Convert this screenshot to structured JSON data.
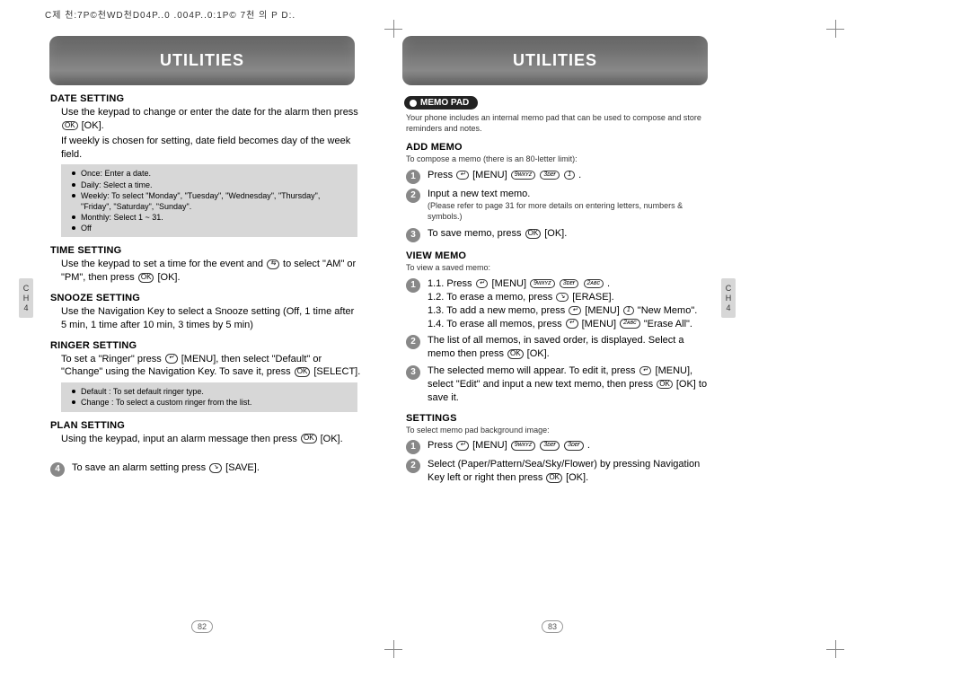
{
  "top_header": "C제 천:7P©천WD천D04P..0 .004P..0:1P© 7천 의 P D:.",
  "side_tab": {
    "line1": "C",
    "line2": "H",
    "line3": "4"
  },
  "left": {
    "banner": "UTILITIES",
    "page_num": "82",
    "sections": {
      "date_setting": {
        "title": "DATE SETTING",
        "p1_a": "Use the keypad to change or enter the date for the alarm then press ",
        "p1_b": " [OK].",
        "p2": "If weekly is chosen for setting, date field becomes day of the week field.",
        "box": [
          "Once: Enter a date.",
          "Daily: Select a time.",
          "Weekly: To select \"Monday\", \"Tuesday\", \"Wednesday\", \"Thursday\", \"Friday\", \"Saturday\", \"Sunday\".",
          "Monthly: Select 1 ~ 31.",
          "Off"
        ]
      },
      "time_setting": {
        "title": "TIME SETTING",
        "p1": "Use the keypad to set a time for the event and ",
        "p2_a": " to select \"AM\" or \"PM\", then press",
        "p2_b": " [OK]."
      },
      "snooze_setting": {
        "title": "SNOOZE SETTING",
        "p": "Use the Navigation Key to select a Snooze setting (Off, 1 time after 5 min, 1 time after 10 min, 3 times by 5 min)"
      },
      "ringer_setting": {
        "title": "RINGER SETTING",
        "p_a": "To set a \"Ringer\" press ",
        "p_b": " [MENU], then select \"Default\" or \"Change\" using the Navigation Key. To save it, press ",
        "p_c": " [SELECT].",
        "box": [
          "Default : To set default ringer type.",
          "Change : To select a custom ringer from the list."
        ]
      },
      "plan_setting": {
        "title": "PLAN SETTING",
        "p_a": "Using the keypad, input an alarm message then press ",
        "p_b": " [OK]."
      },
      "save_step": {
        "num": "4",
        "a": "To save an alarm setting press ",
        "b": " [SAVE]."
      }
    }
  },
  "right": {
    "banner": "UTILITIES",
    "page_num": "83",
    "memo_pill": "MEMO PAD",
    "intro": "Your phone includes an internal memo pad that can be used to compose and store reminders and notes.",
    "add_memo": {
      "title": "ADD MEMO",
      "intro": "To compose a memo (there is an 80-letter limit):",
      "s1_a": "Press ",
      "s1_b": " [MENU] ",
      "s1_c": " .",
      "s2": "Input a new text memo.",
      "s2_note": "(Please refer to page 31 for more details on entering letters, numbers & symbols.)",
      "s3_a": "To save memo, press ",
      "s3_b": " [OK]."
    },
    "view_memo": {
      "title": "VIEW MEMO",
      "intro": "To view a saved memo:",
      "s1_1a": "1.1. Press ",
      "s1_1b": " [MENU] ",
      "s1_1c": " .",
      "s1_2a": "1.2. To erase a memo, press ",
      "s1_2b": " [ERASE].",
      "s1_3a": "1.3. To add a new memo, press ",
      "s1_3b": " [MENU] ",
      "s1_3c": " \"New Memo\".",
      "s1_4a": "1.4. To erase all memos, press ",
      "s1_4b": " [MENU] ",
      "s1_4c": " \"Erase All\".",
      "s2_a": "The list of all memos, in saved order, is displayed. Select a memo then press ",
      "s2_b": " [OK].",
      "s3_a": "The selected memo will appear.  To edit it, press ",
      "s3_b": " [MENU], select \"Edit\" and input a new text memo, then press ",
      "s3_c": " [OK] to save it."
    },
    "settings": {
      "title": "SETTINGS",
      "intro": "To select memo pad background image:",
      "s1_a": "Press ",
      "s1_b": " [MENU] ",
      "s1_c": " .",
      "s2_a": "Select (Paper/Pattern/Sea/Sky/Flower) by pressing Navigation Key left or right then press ",
      "s2_b": " [OK]."
    }
  },
  "icons": {
    "ok": "OK",
    "nav": "⇆",
    "menu": "↵",
    "erase": "↘",
    "k9": "9ᴡxʏz",
    "k3": "3ᴅᴇғ",
    "k2": "2ᴀʙᴄ",
    "k1": "1"
  }
}
